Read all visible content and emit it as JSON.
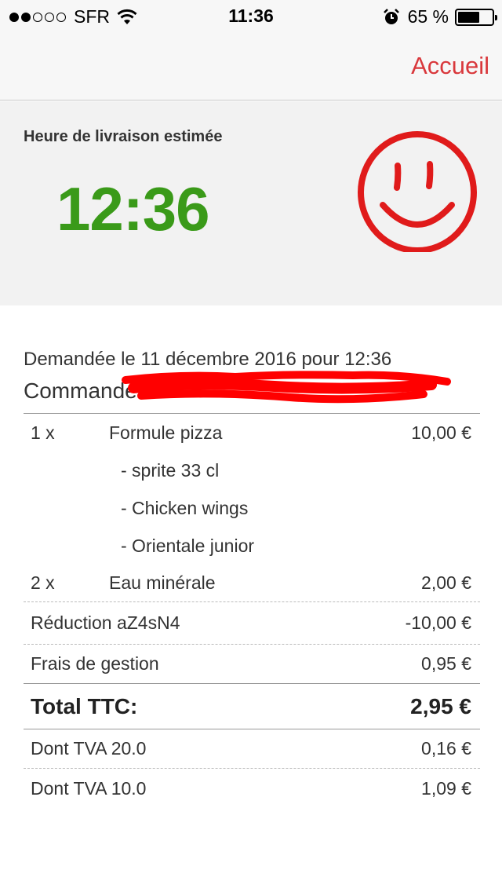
{
  "status_bar": {
    "carrier": "SFR",
    "time": "11:36",
    "battery_percent": "65 %",
    "battery_level": 0.65,
    "signal_bars_filled": 2,
    "signal_bars_total": 5
  },
  "nav": {
    "home_label": "Accueil"
  },
  "eta": {
    "label": "Heure de livraison estimée",
    "time": "12:36"
  },
  "order": {
    "requested_text": "Demandée le 11 décembre 2016 pour 12:36",
    "number_text": "Commande n° :",
    "items": [
      {
        "qty": "1 x",
        "name": "Formule pizza",
        "price": "10,00 €",
        "options": [
          "- sprite 33 cl",
          "- Chicken wings",
          "- Orientale junior"
        ]
      },
      {
        "qty": "2 x",
        "name": "Eau minérale",
        "price": "2,00 €",
        "options": []
      }
    ],
    "discount": {
      "label": "Réduction aZ4sN4",
      "value": "-10,00 €"
    },
    "fees": {
      "label": "Frais de gestion",
      "value": "0,95 €"
    },
    "total": {
      "label": "Total TTC:",
      "value": "2,95 €"
    },
    "vat": [
      {
        "label": "Dont TVA 20.0",
        "value": "0,16 €"
      },
      {
        "label": "Dont TVA 10.0",
        "value": "1,09 €"
      }
    ]
  },
  "colors": {
    "accent": "#d9383c",
    "eta_green": "#3a9a19",
    "smiley_red": "#e01b1b"
  }
}
